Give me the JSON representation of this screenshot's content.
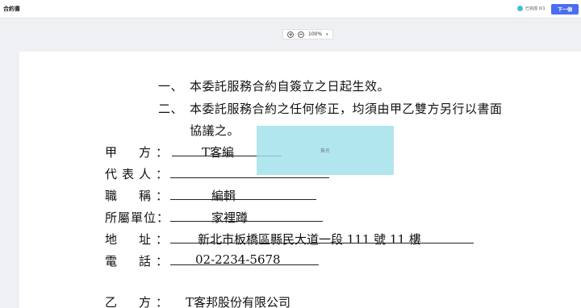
{
  "header": {
    "doc_title": "合約書",
    "progress_text": "已完成 0/1",
    "next_label": "下一個",
    "colors": {
      "accent": "#4b6ef0",
      "progress": "#3ec0d6"
    }
  },
  "zoom": {
    "level": "100%"
  },
  "contract": {
    "clauses": [
      {
        "num": "一、",
        "text": "本委託服務合約自簽立之日起生效。"
      },
      {
        "num": "二、",
        "text": "本委託服務合約之任何修正，均須由甲乙雙方另行以書面",
        "cont": "協議之。"
      }
    ],
    "fields": [
      {
        "label": "甲　方：",
        "value": "T客編"
      },
      {
        "label": "代表人：",
        "value": ""
      },
      {
        "label": "職　稱：",
        "value": "編輯"
      },
      {
        "label": "所屬單位：",
        "value": "家裡蹲"
      },
      {
        "label": "地　址：",
        "value": "新北市板橋區縣民大道一段 111 號 11 樓"
      },
      {
        "label": "電　話：",
        "value": "02-2234-5678"
      },
      {
        "label": "乙　方：",
        "value": "T客邦股份有限公司"
      }
    ],
    "signature_placeholder": "簽名"
  }
}
